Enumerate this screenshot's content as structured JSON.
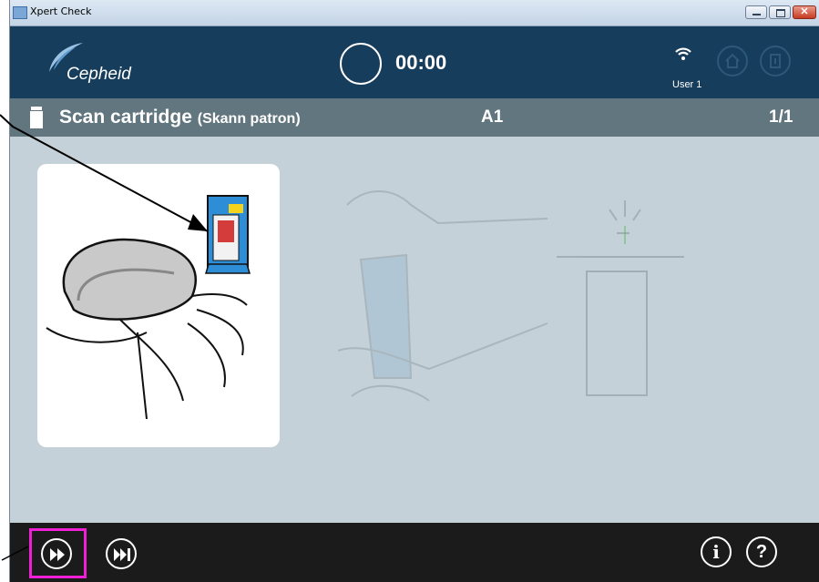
{
  "window": {
    "title": "Xpert Check"
  },
  "header": {
    "logo": "Cepheid",
    "timer": "00:00",
    "user": "User 1",
    "icons": [
      "wifi-icon",
      "home-icon",
      "exit-door-icon"
    ]
  },
  "step": {
    "title": "Scan cartridge",
    "subtitle": "(Skann patron)",
    "position": "A1",
    "count": "1/1",
    "icon": "cartridge-icon"
  },
  "footer": {
    "buttons": [
      "play-icon",
      "skip-to-end-icon",
      "info-icon",
      "help-icon"
    ],
    "info_label": "i",
    "help_label": "?"
  },
  "colors": {
    "header": "#173d5c",
    "stepbar": "#62767f",
    "background": "#c5d1d8",
    "footer": "#1b1b1b",
    "highlight": "#ee1fd5"
  }
}
